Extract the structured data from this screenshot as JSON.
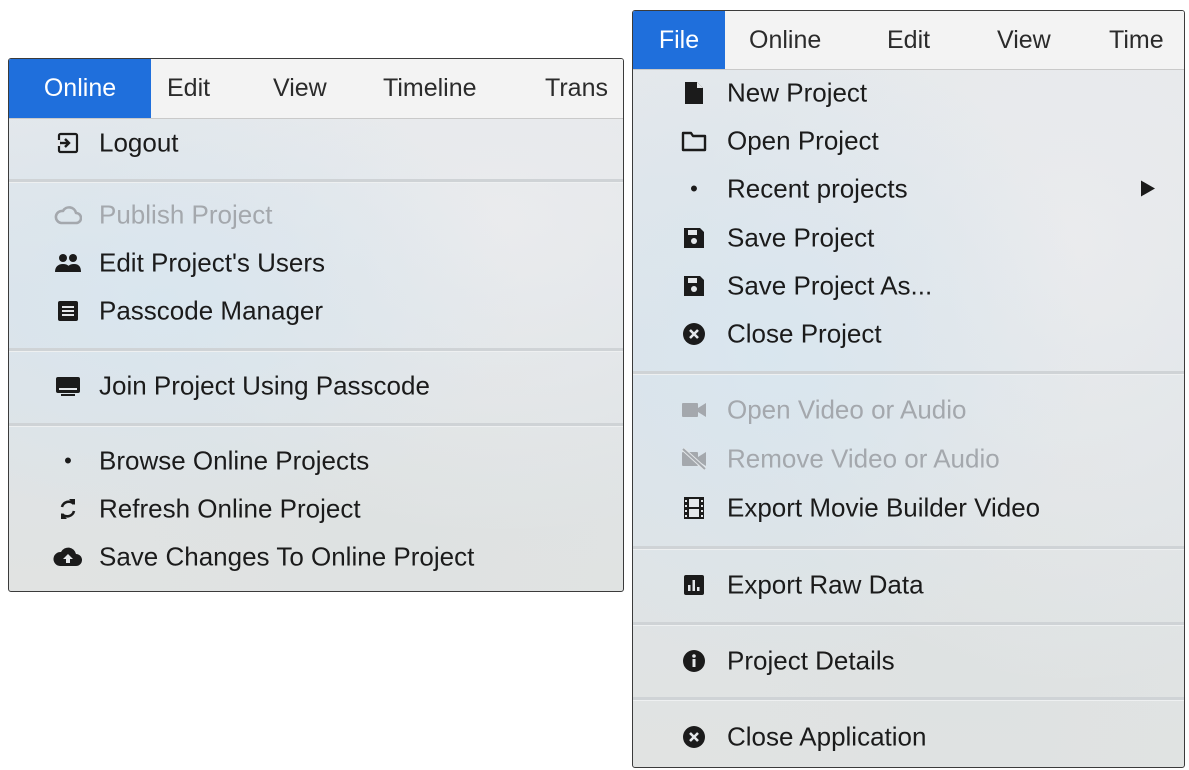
{
  "online_panel": {
    "menubar": [
      "Online",
      "Edit",
      "View",
      "Timeline",
      "Trans"
    ],
    "items": [
      {
        "label": "Logout",
        "icon": "logout-icon"
      },
      {
        "label": "Publish Project",
        "icon": "cloud-outline-icon",
        "disabled": true
      },
      {
        "label": "Edit Project's Users",
        "icon": "users-icon"
      },
      {
        "label": "Passcode Manager",
        "icon": "list-box-icon"
      },
      {
        "label": "Join Project Using Passcode",
        "icon": "keyboard-icon"
      },
      {
        "label": "Browse Online Projects",
        "icon": "dot-icon"
      },
      {
        "label": "Refresh Online Project",
        "icon": "refresh-icon"
      },
      {
        "label": "Save Changes To Online Project",
        "icon": "cloud-upload-icon"
      }
    ]
  },
  "file_panel": {
    "menubar": [
      "File",
      "Online",
      "Edit",
      "View",
      "Time"
    ],
    "items": [
      {
        "label": "New Project",
        "icon": "file-icon"
      },
      {
        "label": "Open Project",
        "icon": "folder-icon"
      },
      {
        "label": "Recent projects",
        "icon": "dot-icon",
        "submenu": true
      },
      {
        "label": "Save Project",
        "icon": "floppy-icon"
      },
      {
        "label": "Save Project As...",
        "icon": "floppy-icon"
      },
      {
        "label": "Close Project",
        "icon": "close-circle-icon"
      },
      {
        "label": "Open Video or Audio",
        "icon": "video-camera-icon",
        "disabled": true
      },
      {
        "label": "Remove Video or Audio",
        "icon": "video-off-icon",
        "disabled": true
      },
      {
        "label": "Export Movie Builder Video",
        "icon": "film-icon"
      },
      {
        "label": "Export Raw Data",
        "icon": "bar-chart-icon"
      },
      {
        "label": "Project Details",
        "icon": "info-circle-icon"
      },
      {
        "label": "Close Application",
        "icon": "close-circle-icon"
      }
    ]
  },
  "colors": {
    "menubar_active": "#1f6fdc",
    "disabled_text": "#a4a8ad",
    "text": "#1b1b1b"
  },
  "glyphs": {
    "dot": "•",
    "submenu_arrow": "▶"
  }
}
